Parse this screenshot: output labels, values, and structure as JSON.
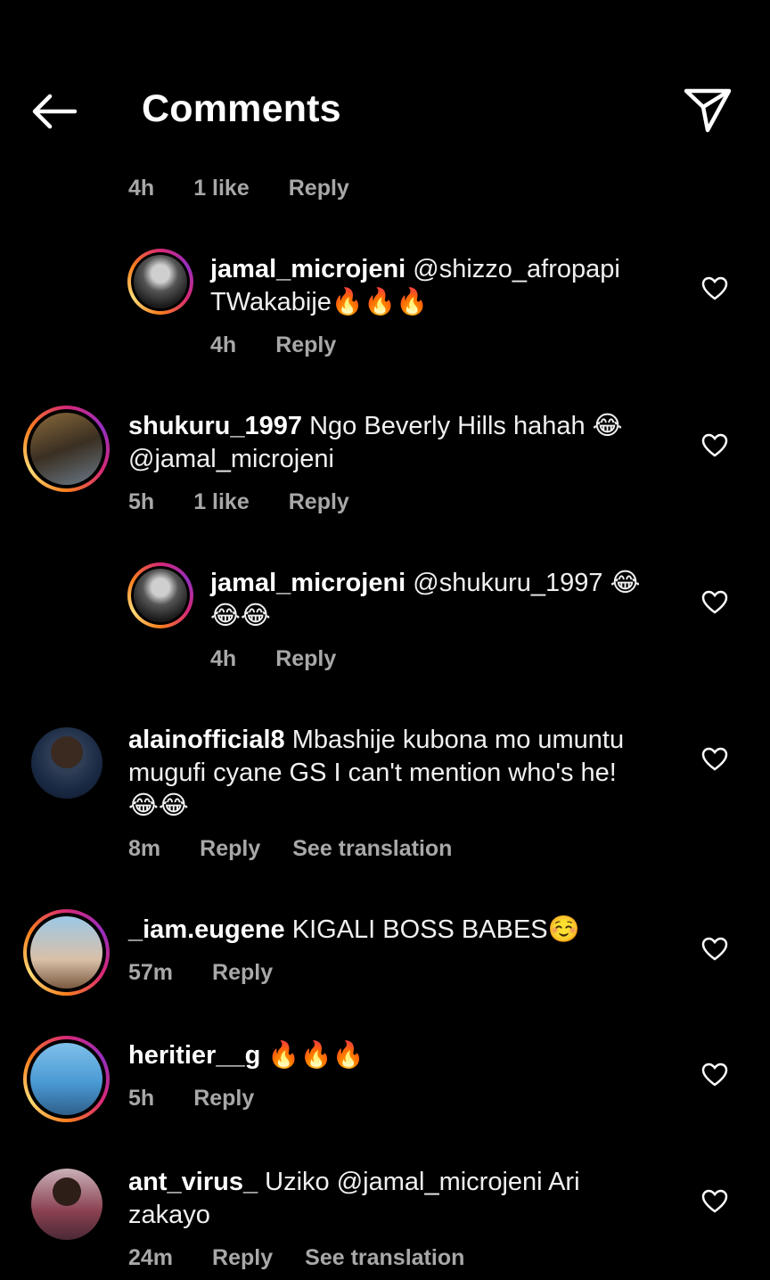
{
  "header": {
    "title": "Comments"
  },
  "top_meta": {
    "time": "4h",
    "likes": "1 like",
    "reply": "Reply"
  },
  "comments": [
    {
      "user": "jamal_microjeni",
      "text": "@shizzo_afropapi",
      "text2": "TWakabije🔥🔥🔥",
      "time": "4h",
      "reply": "Reply"
    },
    {
      "user": "shukuru_1997",
      "text": "Ngo Beverly Hills hahah 😂",
      "text2": "@jamal_microjeni",
      "time": "5h",
      "likes": "1 like",
      "reply": "Reply"
    },
    {
      "user": "jamal_microjeni",
      "text": "@shukuru_1997 😂",
      "text2": "😂😂",
      "time": "4h",
      "reply": "Reply"
    },
    {
      "user": "alainofficial8",
      "text": "Mbashije kubona mo umuntu",
      "text2": "mugufi cyane GS I can't mention who's he!",
      "text3": "😂😂",
      "time": "8m",
      "reply": "Reply",
      "translate": "See translation"
    },
    {
      "user": "_iam.eugene",
      "text": "KIGALI BOSS BABES☺️",
      "time": "57m",
      "reply": "Reply"
    },
    {
      "user": "heritier__g",
      "text": "🔥🔥🔥",
      "time": "5h",
      "reply": "Reply"
    },
    {
      "user": "ant_virus_",
      "text": "Uziko @jamal_microjeni Ari",
      "text2": "zakayo",
      "time": "24m",
      "reply": "Reply",
      "translate": "See translation"
    }
  ],
  "colors": {
    "background": "#000000",
    "text": "#ffffff",
    "meta": "#a8a8a8",
    "story_ring": [
      "#d62976",
      "#fa7e1e",
      "#feda75"
    ]
  },
  "icons": {
    "back": "arrow-left-icon",
    "share": "paper-plane-icon",
    "like": "heart-outline-icon"
  }
}
